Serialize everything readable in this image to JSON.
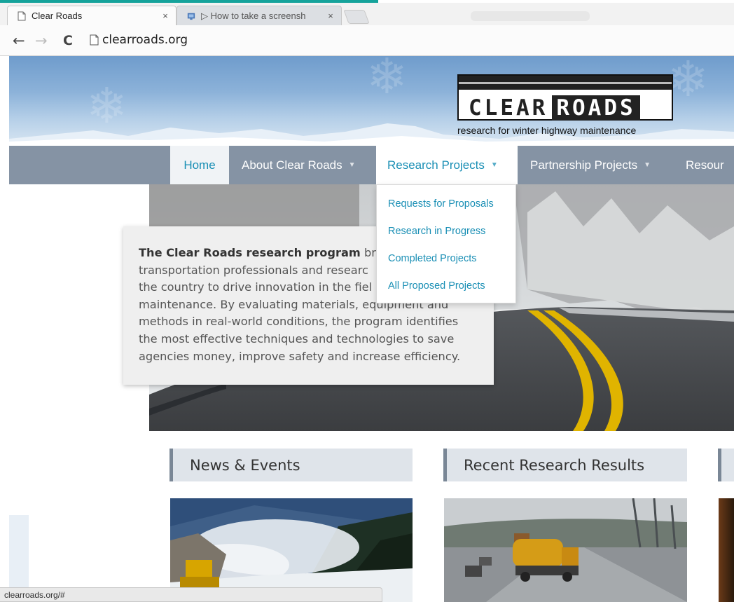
{
  "browser": {
    "tabs": [
      {
        "title": "Clear Roads",
        "close": "×"
      },
      {
        "title": "▷ How to take a screensh",
        "close": "×"
      }
    ],
    "url": "clearroads.org",
    "status_url": "clearroads.org/#"
  },
  "site": {
    "logo": {
      "word1": "CLEAR",
      "word2": "ROADS"
    },
    "tagline": "research for winter highway maintenance",
    "nav": {
      "home": "Home",
      "about": "About Clear Roads",
      "research": "Research Projects",
      "partnership": "Partnership Projects",
      "resources": "Resour"
    },
    "research_dropdown": [
      "Requests for Proposals",
      "Research in Progress",
      "Completed Projects",
      "All Proposed Projects"
    ],
    "intro": {
      "lead": "The Clear Roads research program",
      "line1_rest": " brin",
      "line2": "transportation professionals and researc",
      "line3": "the country to drive innovation in the fiel",
      "line4": "maintenance. By evaluating materials, equipment and",
      "line5": "methods in real-world conditions, the program identifies",
      "line6": "the most effective techniques and technologies to save",
      "line7": "agencies money, improve safety and increase efficiency."
    },
    "sections": {
      "news": "News & Events",
      "recent": "Recent Research Results"
    }
  },
  "colors": {
    "accent": "#15a39b",
    "nav_bg": "#8593a4",
    "link": "#1a8fb5"
  }
}
